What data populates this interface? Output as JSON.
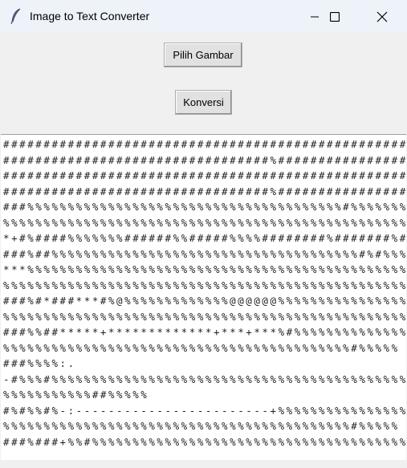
{
  "window": {
    "title": "Image to Text Converter",
    "icon": "feather-icon"
  },
  "buttons": {
    "choose_image": "Pilih Gambar",
    "convert": "Konversi"
  },
  "output_lines": [
    "##################################################",
    "#################################%################",
    "##################################################",
    "#################################%################",
    "###%%%%%%%%%%%%%%%%%%%%%%%%%%%%%%%%%%%%%%%#%%%%%%%",
    "%%%%%%%%%%%%%%%%%%%%%%%%%%%%%%%%%%%%%%%%%%%%%%%%%%",
    "*+#%####%%%%%%%######%%#####%%%%########%#######%#",
    "###%##%%%%%%%%%%%%%%%%%%%%%%%%%%%%%%%%%%%%%%#%#%%%",
    "***%%%%%%%%%%%%%%%%%%%%%%%%%%%%%%%%%%%%%%%%%%%%%%%",
    "%%%%%%%%%%%%%%%%%%%%%%%%%%%%%%%%%%%%%%%%%%%%%%%%%%",
    "###%#*###***#%@%%%%%%%%%%%%%@@@@@@%%%%%%%%%%%%%%%%",
    "%%%%%%%%%%%%%%%%%%%%%%%%%%%%%%%%%%%%%%%%%%%%%%%%%%",
    "###%%##*****+*************+***+***%#%%%%%%%%%%%%%%",
    "%%%%%%%%%%%%%%%%%%%%%%%%%%%%%%%%%%%%%%%%%%%#%%%%%",
    "###%%%%:.",
    "-#%%%#%%%%%%%%%%%%%%%%%%%%%%%%%%%%%%%%%%%%%%%%%%%%",
    "%%%%%%%%%%%##%%%%%",
    "#%#%%#%-:------------------------+%%%%%%%%%%%%%%%%",
    "%%%%%%%%%%%%%%%%%%%%%%%%%%%%%%%%%%%%%%%%%%%#%%%%%",
    "###%###+%%#%%%%%%%%%%%%%%%%%%%%%%%%%%%%%%%%%%%%%%%"
  ]
}
